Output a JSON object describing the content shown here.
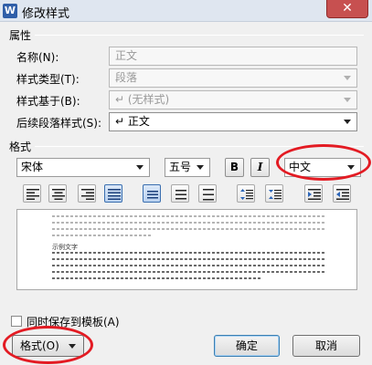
{
  "window": {
    "title": "修改样式",
    "app_icon_letter": "W",
    "close_symbol": "✕"
  },
  "properties": {
    "section_label": "属性",
    "name": {
      "label": "名称(N):",
      "value": "正文"
    },
    "style_type": {
      "label": "样式类型(T):",
      "value": "段落"
    },
    "based_on": {
      "label": "样式基于(B):",
      "value": "↵ (无样式)"
    },
    "next_style": {
      "label": "后续段落样式(S):",
      "value": "↵ 正文"
    }
  },
  "format": {
    "section_label": "格式",
    "font": "宋体",
    "size": "五号",
    "bold_label": "B",
    "italic_label": "I",
    "script": "中文"
  },
  "preview": {
    "sample_text": "示例文字"
  },
  "save_to_template": {
    "label": "同时保存到模板(A)",
    "checked": false
  },
  "buttons": {
    "format": "格式(O)",
    "ok": "确定",
    "cancel": "取消"
  },
  "annotations": {
    "marker_color": "#e31b23"
  }
}
